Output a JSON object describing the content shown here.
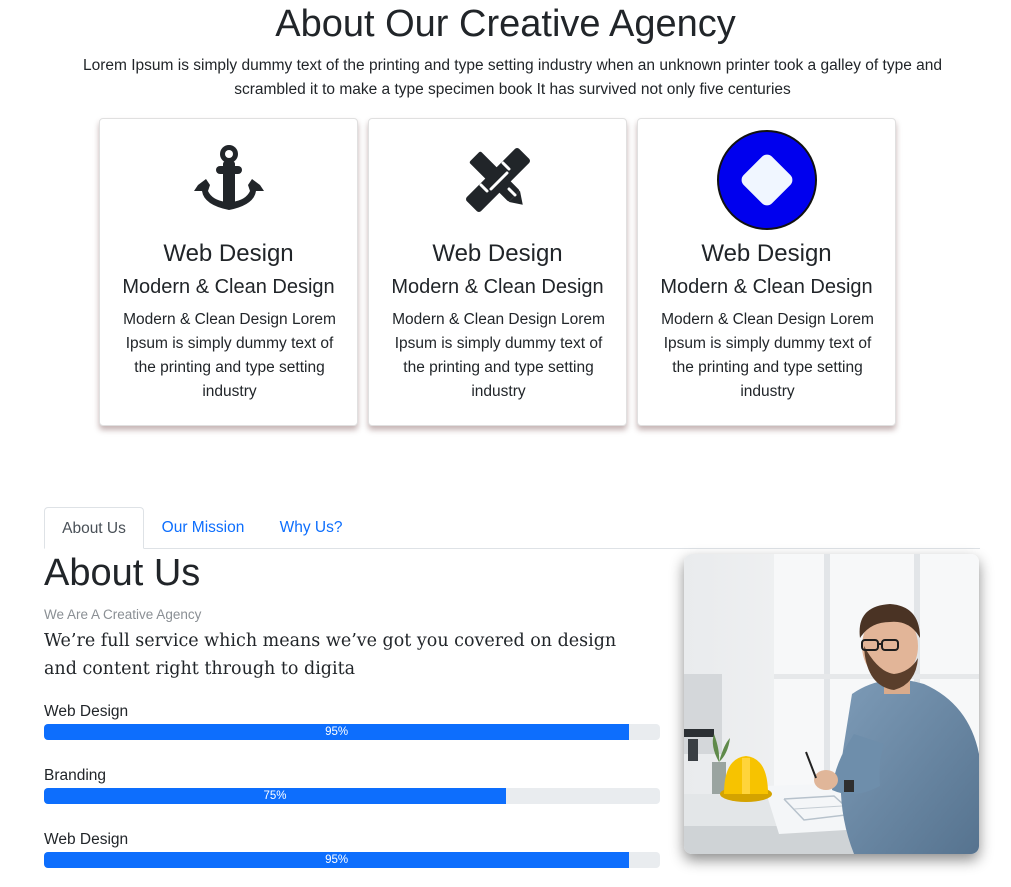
{
  "hero": {
    "title": "About Our Creative Agency",
    "intro": "Lorem Ipsum is simply dummy text of the printing and type setting industry when an unknown printer took a galley of type and scrambled it to make a type specimen book It has survived not only five centuries"
  },
  "cards": [
    {
      "icon": "anchor-icon",
      "title": "Web Design",
      "subtitle": "Modern & Clean Design",
      "text": "Modern & Clean Design Lorem Ipsum is simply dummy text of the printing and type setting industry"
    },
    {
      "icon": "pencil-ruler-icon",
      "title": "Web Design",
      "subtitle": "Modern & Clean Design",
      "text": "Modern & Clean Design Lorem Ipsum is simply dummy text of the printing and type setting industry"
    },
    {
      "icon": "diamond-circle-icon",
      "title": "Web Design",
      "subtitle": "Modern & Clean Design",
      "text": "Modern & Clean Design Lorem Ipsum is simply dummy text of the printing and type setting industry"
    }
  ],
  "tabs": [
    {
      "label": "About Us",
      "active": true
    },
    {
      "label": "Our Mission",
      "active": false
    },
    {
      "label": "Why Us?",
      "active": false
    }
  ],
  "about": {
    "title": "About Us",
    "kicker": "We Are A Creative Agency",
    "lead": "We’re full service which means we’ve got you covered on design and content right through to digita"
  },
  "skills": [
    {
      "label": "Web Design",
      "percent": 95,
      "percent_label": "95%"
    },
    {
      "label": "Branding",
      "percent": 75,
      "percent_label": "75%"
    },
    {
      "label": "Web Design",
      "percent": 95,
      "percent_label": "95%"
    }
  ],
  "colors": {
    "accent": "#0d6efd",
    "icon_dark": "#212529",
    "icon_circle": "#0000ee",
    "track": "#e9ecef"
  }
}
